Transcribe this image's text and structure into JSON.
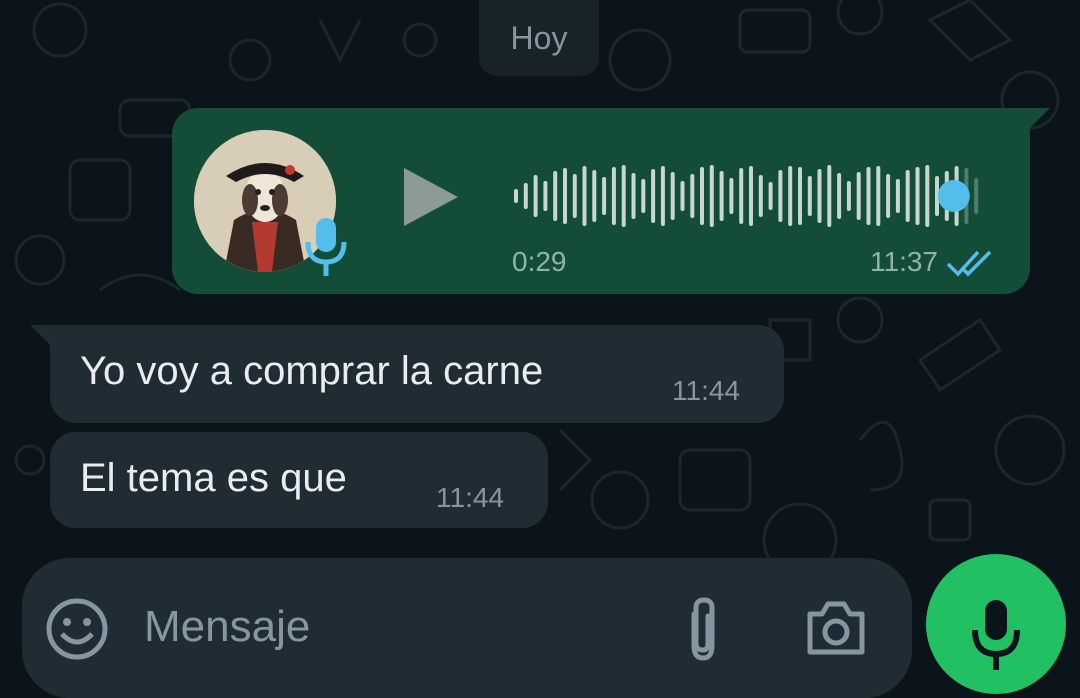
{
  "chat": {
    "date_chip": "Hoy",
    "voice_message": {
      "duration": "0:29",
      "time": "11:37",
      "status": "read",
      "accent_color": "#53bdeb",
      "playback_progress": 0.94
    },
    "messages": [
      {
        "text": "Yo voy a comprar la carne",
        "time": "11:44"
      },
      {
        "text": "El tema es que",
        "time": "11:44"
      }
    ]
  },
  "composer": {
    "placeholder": "Mensaje",
    "emoji_icon": "emoji-icon",
    "attach_icon": "paperclip-icon",
    "camera_icon": "camera-icon",
    "mic_icon": "microphone-icon",
    "send_color": "#21c063"
  }
}
